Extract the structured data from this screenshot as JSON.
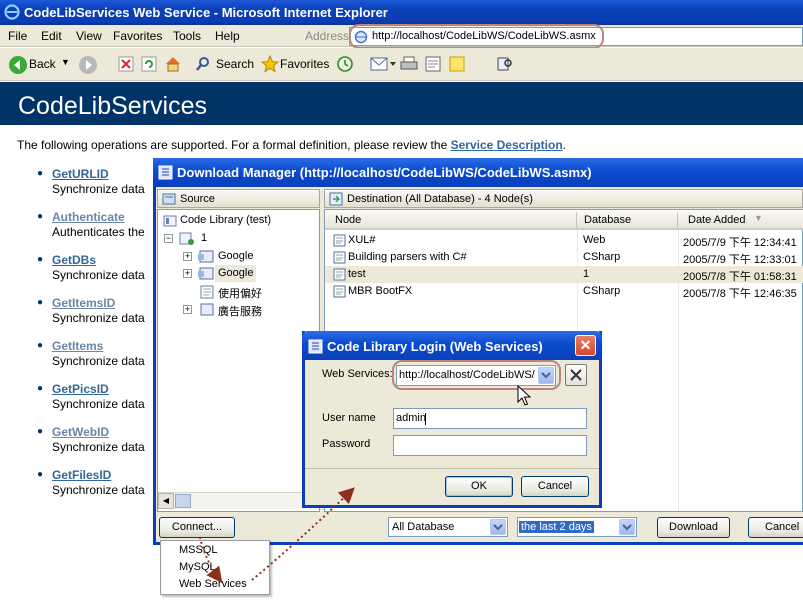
{
  "browser": {
    "title": "CodeLibServices Web Service - Microsoft Internet Explorer",
    "menu": [
      "File",
      "Edit",
      "View",
      "Favorites",
      "Tools",
      "Help"
    ],
    "address_label": "Address",
    "address_url": "http://localhost/CodeLibWS/CodeLibWS.asmx",
    "toolbar": {
      "back": "Back",
      "search": "Search",
      "favorites": "Favorites"
    }
  },
  "page": {
    "heading": "CodeLibServices",
    "intro": "The following operations are supported. For a formal definition, please review the",
    "intro_link": "Service Description",
    "intro_end": ".",
    "operations": [
      {
        "name": "GetURLID",
        "desc": "Synchronize data"
      },
      {
        "name": "Authenticate",
        "desc": "Authenticates the"
      },
      {
        "name": "GetDBs",
        "desc": "Synchronize data"
      },
      {
        "name": "GetItemsID",
        "desc": "Synchronize data"
      },
      {
        "name": "GetItems",
        "desc": "Synchronize data"
      },
      {
        "name": "GetPicsID",
        "desc": "Synchronize data"
      },
      {
        "name": "GetWebID",
        "desc": "Synchronize data"
      },
      {
        "name": "GetFilesID",
        "desc": "Synchronize data"
      }
    ]
  },
  "download_manager": {
    "title": "Download Manager (http://localhost/CodeLibWS/CodeLibWS.asmx)",
    "source_header": "Source",
    "destination_header": "Destination (All Database) - 4 Node(s)",
    "tree": [
      "Code Library (test)",
      "1",
      "Google",
      "Google",
      "使用偏好",
      "廣告服務"
    ],
    "columns": [
      "Node",
      "Database",
      "Date Added"
    ],
    "rows": [
      {
        "node": "XUL#",
        "database": "Web",
        "date": "2005/7/9 下午 12:34:41"
      },
      {
        "node": "Building parsers with C#",
        "database": "CSharp",
        "date": "2005/7/9 下午 12:33:01"
      },
      {
        "node": "test",
        "database": "1",
        "date": "2005/7/8 下午 01:58:31"
      },
      {
        "node": "MBR BootFX",
        "database": "CSharp",
        "date": "2005/7/8 下午 12:46:35"
      }
    ],
    "connect_button": "Connect...",
    "database_filter": "All Database",
    "time_filter": "the last 2 days",
    "download_button": "Download",
    "cancel_button": "Cancel"
  },
  "connect_menu": [
    "MSSQL",
    "MySQL",
    "Web Services"
  ],
  "login": {
    "title": "Code Library Login (Web Services)",
    "web_services_label": "Web Services:",
    "web_services_value": "http://localhost/CodeLibWS/",
    "user_name_label": "User name",
    "user_name_value": "admin",
    "password_label": "Password",
    "ok": "OK",
    "cancel": "Cancel"
  },
  "colors": {
    "titlebar": "#0a3fb8",
    "page_header": "#003366",
    "link": "#336699",
    "annotation": "#8b2f1f"
  }
}
